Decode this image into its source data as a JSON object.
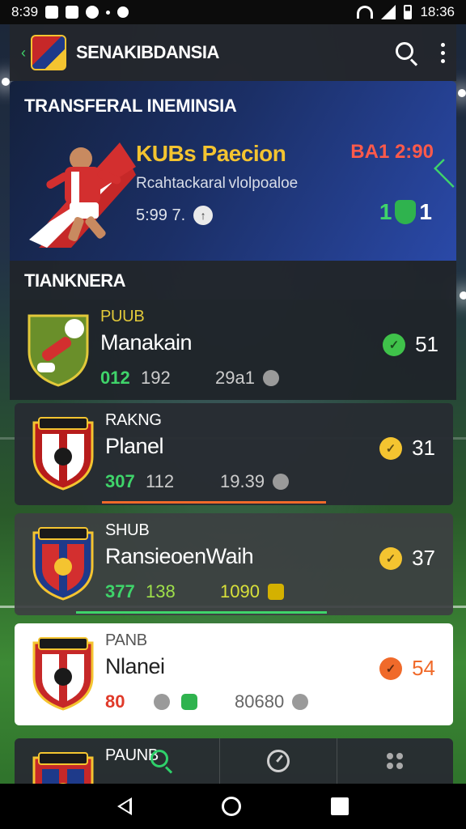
{
  "status_bar": {
    "time_left": "8:39",
    "time_right": "18:36"
  },
  "app_bar": {
    "title": "SENAKIBDANSIA"
  },
  "featured": {
    "header": "TRANSFERAL  INEMINSIA",
    "title": "KUBs Paecion",
    "subtitle": "Rcahtackaral vlolpoaloe",
    "stat": "5:99 7.",
    "time": "BA1 2:90",
    "score_left": "1",
    "score_right": "1",
    "score_color": "#3fd46a"
  },
  "section": {
    "title": "TIANKNERA"
  },
  "items": [
    {
      "category": "PUUB",
      "name": "Manakain",
      "stat1": "012",
      "stat1_color": "#3fd46a",
      "stat2": "192",
      "stat3": "29a1",
      "rating": "51",
      "rating_color": "#3fc24a",
      "progress": null
    },
    {
      "category": "RAKNG",
      "name": "Planel",
      "stat1": "307",
      "stat1_color": "#3fd46a",
      "stat2": "112",
      "stat3": "19.39",
      "rating": "31",
      "rating_color": "#f4c430",
      "progress": 0.66,
      "progress_color": "#f06a2a"
    },
    {
      "category": "SHUB",
      "name": "RansieoenWaih",
      "stat1": "377",
      "stat1_color": "#3fd46a",
      "stat2": "138",
      "stat2_color": "#9fe04a",
      "stat3": "1090",
      "stat3_color": "#d8e03a",
      "rating": "37",
      "rating_color": "#f4c430",
      "progress": 0.72,
      "progress_color": "#3fd46a"
    },
    {
      "category": "PANB",
      "name": "Nlanei",
      "stat1": "80",
      "stat1_color": "#e03a2a",
      "stat2": "",
      "stat3": "80680",
      "rating": "54",
      "rating_color": "#f06a2a",
      "progress": null
    },
    {
      "category": "PAUNB",
      "name": "",
      "stat1": "",
      "stat2": "",
      "stat3": "",
      "rating": "",
      "rating_color": "#f4c430",
      "progress": null
    }
  ],
  "colors": {
    "accent_green": "#2fd06a",
    "accent_gold": "#f4c430",
    "accent_red": "#e03a2a"
  },
  "bottom_tabs": [
    "search-icon",
    "history-icon",
    "more-icon"
  ]
}
